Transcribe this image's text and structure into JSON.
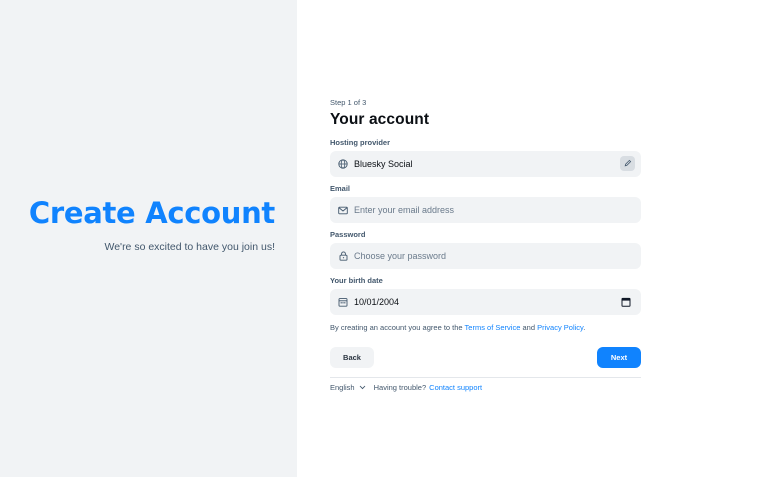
{
  "hero": {
    "title": "Create Account",
    "subtitle": "We're so excited to have you join us!"
  },
  "form": {
    "step": "Step 1 of 3",
    "title": "Your account",
    "hosting": {
      "label": "Hosting provider",
      "value": "Bluesky Social",
      "icon": "globe-icon",
      "action_icon": "pencil-icon"
    },
    "email": {
      "label": "Email",
      "placeholder": "Enter your email address",
      "value": "",
      "icon": "envelope-icon"
    },
    "password": {
      "label": "Password",
      "placeholder": "Choose your password",
      "value": "",
      "icon": "lock-icon"
    },
    "birth": {
      "label": "Your birth date",
      "value": "10/01/2004",
      "icon": "calendar-icon"
    },
    "legal": {
      "prefix": "By creating an account you agree to the",
      "terms": "Terms of Service",
      "and": "and",
      "privacy": "Privacy Policy",
      "suffix": "."
    },
    "back_label": "Back",
    "next_label": "Next"
  },
  "footer": {
    "language": "English",
    "trouble": "Having trouble?",
    "support": "Contact support"
  },
  "colors": {
    "accent": "#1083fe",
    "panel": "#f1f3f5",
    "text_muted": "#42576c"
  }
}
